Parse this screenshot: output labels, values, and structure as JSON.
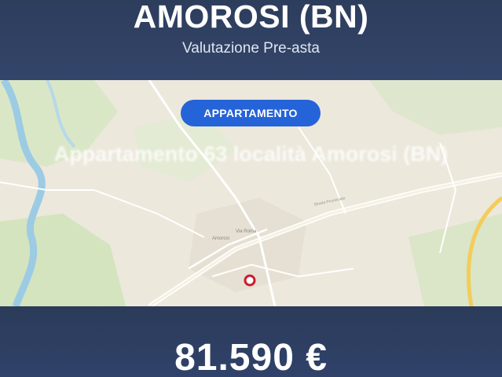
{
  "header": {
    "title": "AMOROSI (BN)",
    "subtitle": "Valutazione Pre-asta"
  },
  "badge": {
    "label": "APPARTAMENTO",
    "color": "#2563d8"
  },
  "address": "Appartamento 63 località Amorosi (BN)",
  "map": {
    "town_label": "Amorosi",
    "marker_color": "#c81e2e"
  },
  "price": "81.590 €",
  "colors": {
    "banner": "#2f4060",
    "map_background": "#ece8dc",
    "river": "#9ccbe4",
    "green_area": "#cfe3b8"
  }
}
